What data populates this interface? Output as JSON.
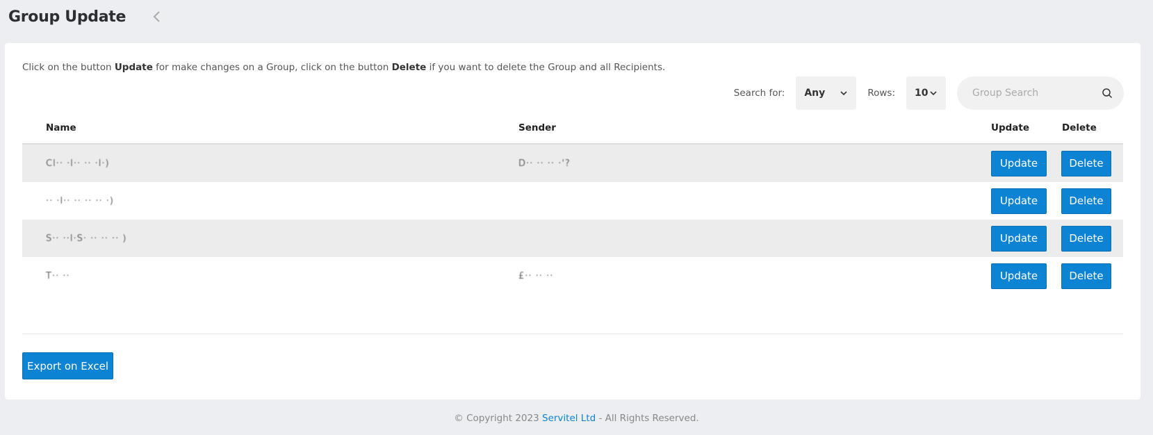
{
  "header": {
    "title": "Group Update"
  },
  "intro": {
    "part1": "Click on the button ",
    "bold1": "Update",
    "part2": " for make changes on a Group, click on the button ",
    "bold2": "Delete",
    "part3": " if you want to delete the Group and all Recipients."
  },
  "controls": {
    "search_for_label": "Search for:",
    "search_for_value": "Any",
    "rows_label": "Rows:",
    "rows_value": "10",
    "search_placeholder": "Group Search"
  },
  "table": {
    "headers": {
      "name": "Name",
      "sender": "Sender",
      "update": "Update",
      "delete": "Delete"
    },
    "rows": [
      {
        "name": "Cl·· ·l·· ·· ·l·)",
        "sender": "D·· ·· ·· ·'?",
        "update": "Update",
        "delete": "Delete"
      },
      {
        "name": "·· ·l·· ·· ·· ·· ·)",
        "sender": "",
        "update": "Update",
        "delete": "Delete"
      },
      {
        "name": "S·· ··l·S· ·· ·· ·· )",
        "sender": "",
        "update": "Update",
        "delete": "Delete"
      },
      {
        "name": "T·· ··",
        "sender": "£·· ·· ··",
        "update": "Update",
        "delete": "Delete"
      }
    ]
  },
  "export": {
    "label": "Export on Excel"
  },
  "footer": {
    "prefix": "© Copyright 2023 ",
    "company": "Servitel Ltd",
    "suffix": " - All Rights Reserved."
  },
  "colors": {
    "accent": "#0d83d3",
    "background": "#eceef2"
  },
  "icons": {
    "back": "chevron-left-icon",
    "dropdown": "chevron-down-icon",
    "search": "search-icon"
  }
}
